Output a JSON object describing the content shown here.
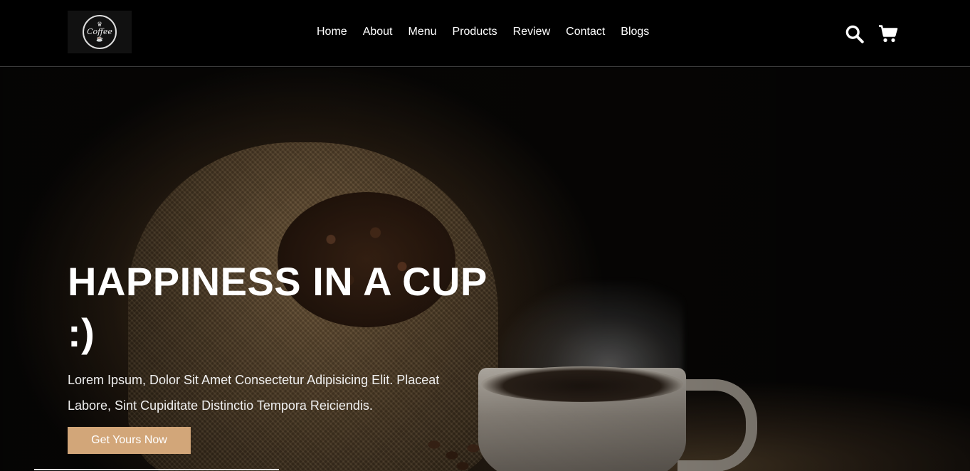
{
  "header": {
    "logo_text": "Coffee",
    "nav": [
      "Home",
      "About",
      "Menu",
      "Products",
      "Review",
      "Contact",
      "Blogs"
    ],
    "icons": [
      "search-icon",
      "cart-icon"
    ]
  },
  "hero": {
    "title": "HAPPINESS IN A CUP :)",
    "text": "Lorem Ipsum, Dolor Sit Amet Consectetur Adipisicing Elit. Placeat Labore, Sint Cupiditate Distinctio Tempora Reiciendis.",
    "button_label": "Get Yours Now"
  },
  "colors": {
    "background": "#000000",
    "accent": "#d2a679",
    "text": "#ffffff"
  }
}
